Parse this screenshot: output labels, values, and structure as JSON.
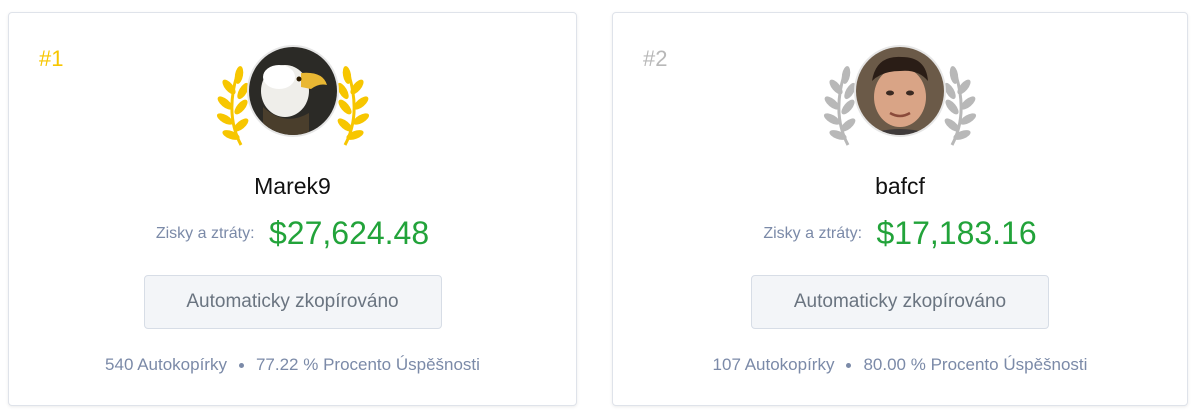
{
  "leaders": [
    {
      "rank": "#1",
      "username": "Marek9",
      "pnl_label": "Zisky a ztráty:",
      "pnl_value": "$27,624.48",
      "copy_button": "Automaticky zkopírováno",
      "copiers": "540 Autokopírky",
      "success": "77.22 % Procento Úspěšnosti",
      "wreath_color": "#f7c600",
      "avatar_icon": "eagle-avatar"
    },
    {
      "rank": "#2",
      "username": "bafcf",
      "pnl_label": "Zisky a ztráty:",
      "pnl_value": "$17,183.16",
      "copy_button": "Automaticky zkopírováno",
      "copiers": "107 Autokopírky",
      "success": "80.00 % Procento Úspěšnosti",
      "wreath_color": "#b8b8b8",
      "avatar_icon": "person-avatar"
    }
  ],
  "colors": {
    "profit_green": "#22a33a",
    "muted_text": "#7b8aa8",
    "gold": "#f7c600",
    "silver": "#b8b8b8"
  }
}
